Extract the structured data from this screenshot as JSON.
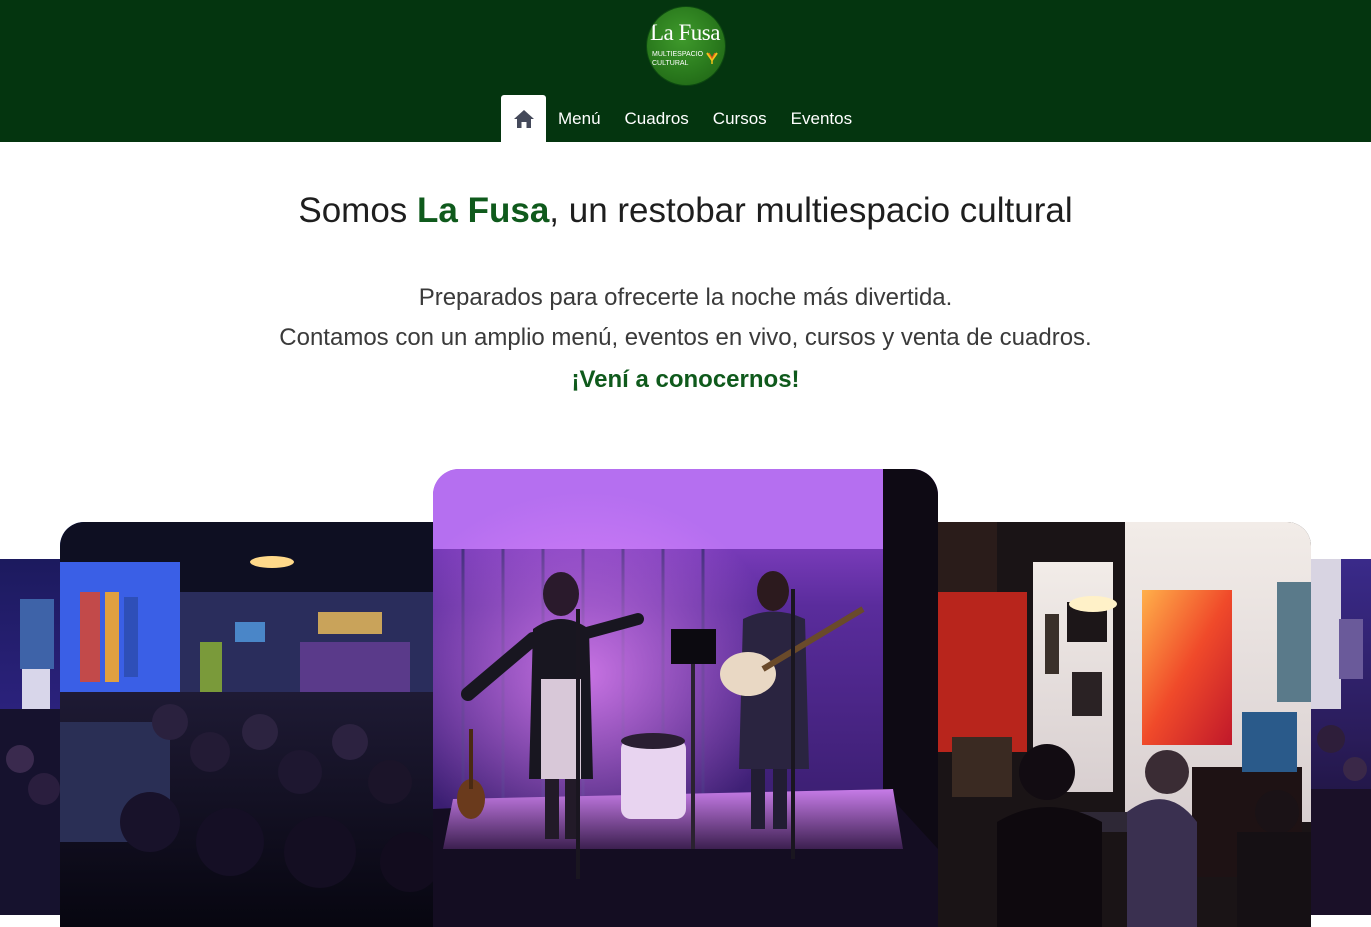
{
  "header": {
    "logo": {
      "title": "La Fusa",
      "subtitle_line1": "MULTIESPACIO",
      "subtitle_line2": "CULTURAL"
    },
    "nav": {
      "home_icon": "home-icon",
      "items": [
        "Menú",
        "Cuadros",
        "Cursos",
        "Eventos"
      ]
    },
    "colors": {
      "header_bg": "#04350f",
      "brand_green": "#0f5a1c"
    }
  },
  "hero": {
    "title_prefix": "Somos ",
    "title_brand": "La Fusa",
    "title_suffix": ", un restobar multiespacio cultural",
    "line1": "Preparados para ofrecerte la noche más divertida.",
    "line2": "Contamos con un amplio menú, eventos en vivo, cursos y venta de cuadros.",
    "cta": "¡Vení a conocernos!"
  },
  "gallery": {
    "photos": [
      "bar-interior-photo",
      "bar-crowd-photo",
      "live-music-stage-photo",
      "piano-gallery-photo",
      "diners-photo"
    ]
  }
}
